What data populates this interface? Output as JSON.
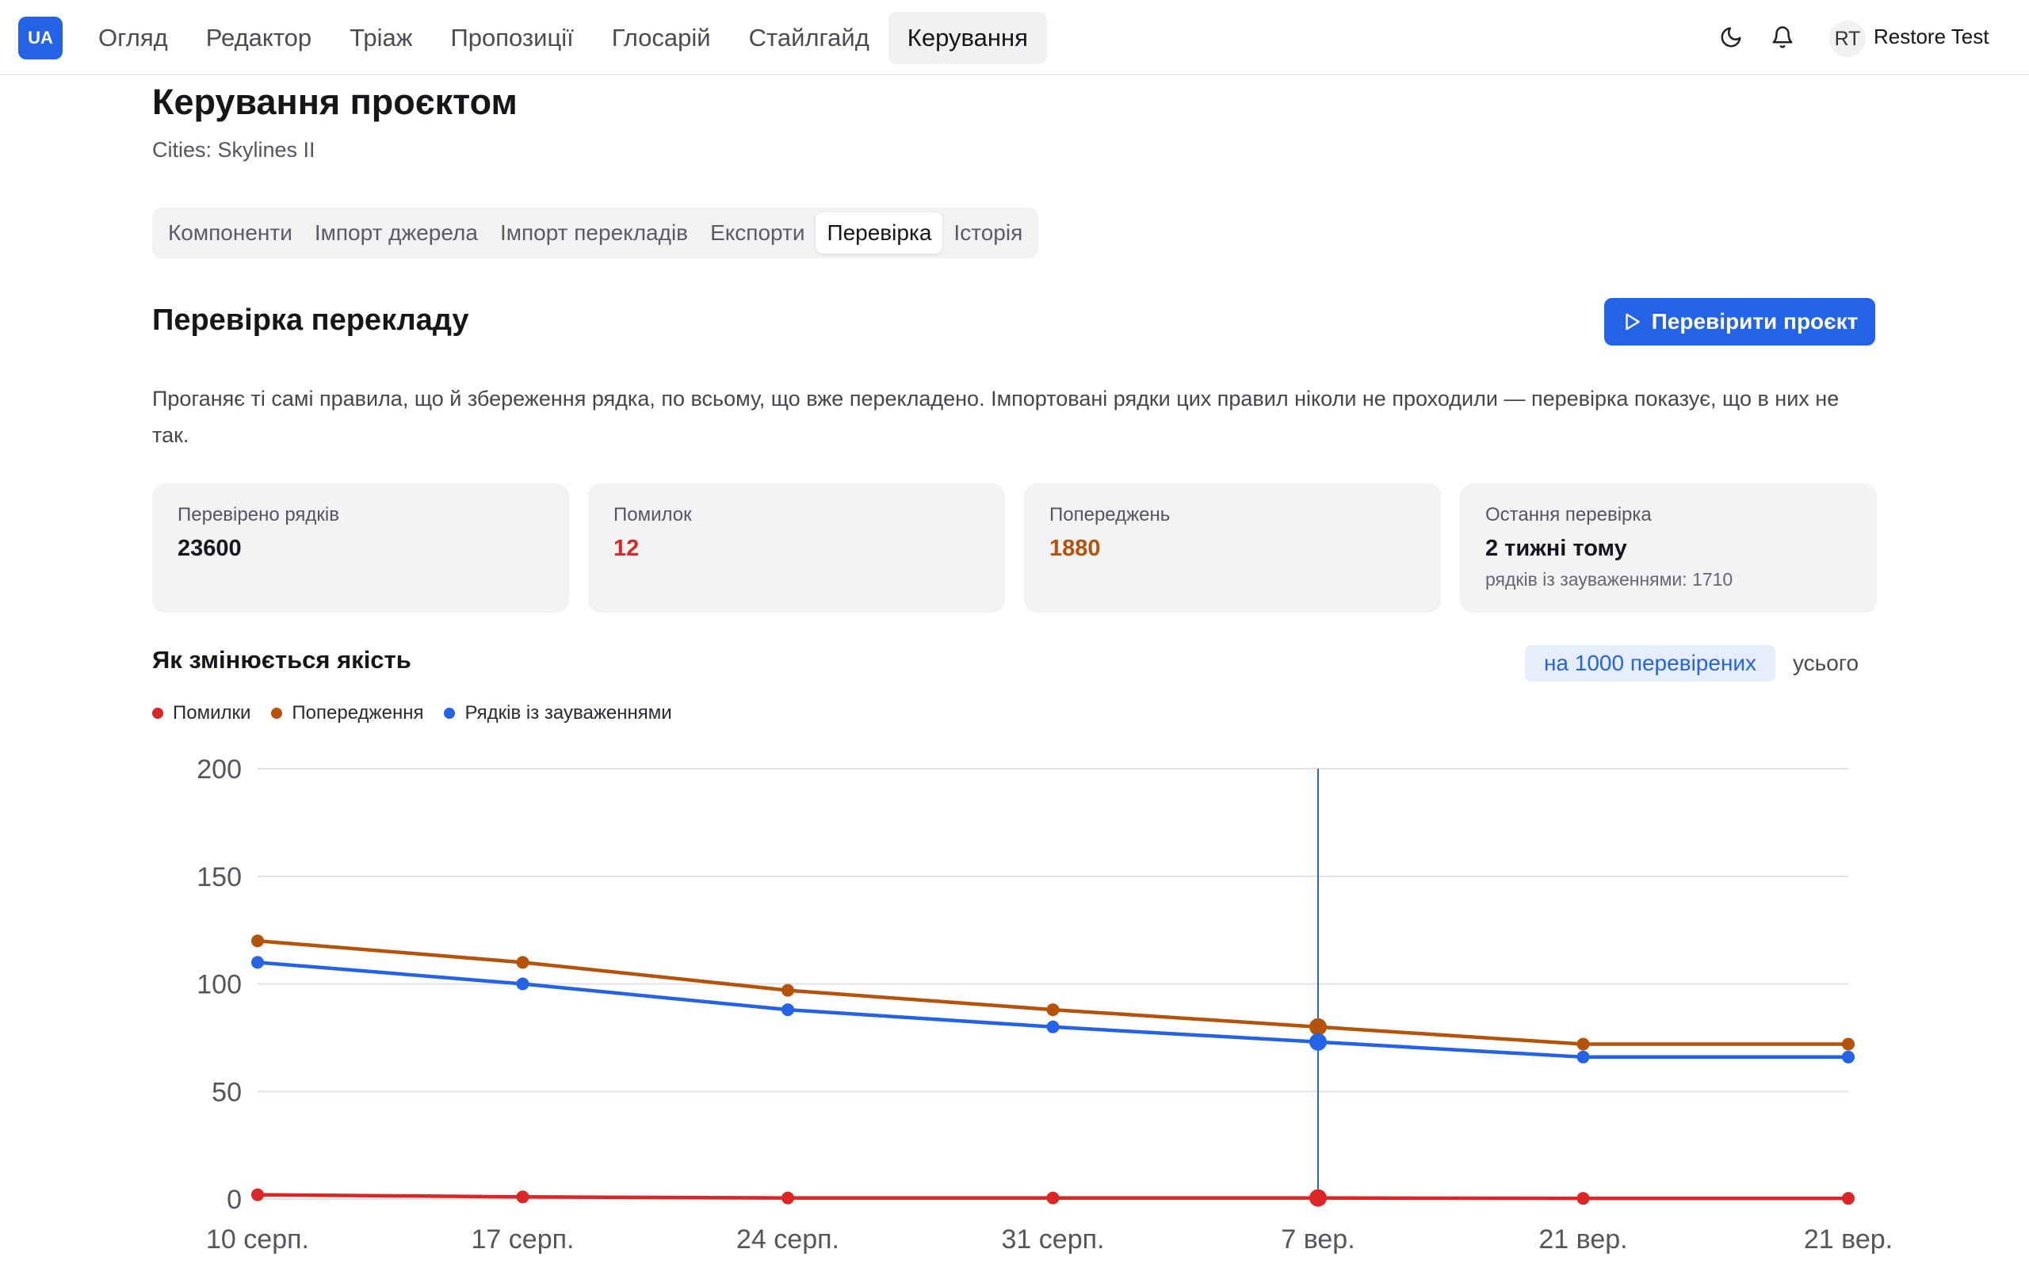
{
  "brand": {
    "logo_text": "UA",
    "color": "#2463e8"
  },
  "nav": {
    "items": [
      {
        "label": "Огляд",
        "active": false
      },
      {
        "label": "Редактор",
        "active": false
      },
      {
        "label": "Тріаж",
        "active": false
      },
      {
        "label": "Пропозиції",
        "active": false
      },
      {
        "label": "Глосарій",
        "active": false
      },
      {
        "label": "Стайлгайд",
        "active": false
      },
      {
        "label": "Керування",
        "active": true
      }
    ]
  },
  "user": {
    "initials": "RT",
    "name": "Restore Test"
  },
  "icons": {
    "theme": "moon-icon",
    "notifications": "bell-icon",
    "run": "play-icon"
  },
  "page": {
    "title": "Керування проєктом",
    "subtitle": "Cities: Skylines II"
  },
  "tabs": [
    {
      "label": "Компоненти",
      "active": false
    },
    {
      "label": "Імпорт джерела",
      "active": false
    },
    {
      "label": "Імпорт перекладів",
      "active": false
    },
    {
      "label": "Експорти",
      "active": false
    },
    {
      "label": "Перевірка",
      "active": true
    },
    {
      "label": "Історія",
      "active": false
    }
  ],
  "section": {
    "title": "Перевірка перекладу",
    "run_button": "Перевірити проєкт",
    "description": "Проганяє ті самі правила, що й збереження рядка, по всьому, що вже перекладено. Імпортовані рядки цих правил ніколи не проходили — перевірка показує, що в них не так."
  },
  "stats": [
    {
      "label": "Перевірено рядків",
      "value": "23600",
      "color": "#16161a"
    },
    {
      "label": "Помилок",
      "value": "12",
      "color": "#dc2626"
    },
    {
      "label": "Попереджень",
      "value": "1880",
      "color": "#b45309"
    },
    {
      "label": "Остання перевірка",
      "value": "2 тижні тому",
      "note": "рядків із зауваженнями: 1710",
      "color": "#16161a"
    }
  ],
  "chart_header": {
    "title": "Як змінюється якість",
    "toggle_active": "на 1000 перевірених",
    "toggle_other": "усього"
  },
  "chart_data": {
    "type": "line",
    "categories": [
      "10 серп.",
      "17 серп.",
      "24 серп.",
      "31 серп.",
      "7 вер.",
      "21 вер.",
      "21 вер."
    ],
    "ylim": [
      0,
      200
    ],
    "yticks": [
      0,
      50,
      100,
      150,
      200
    ],
    "grid": true,
    "legend": "top-left",
    "highlighted_category_index": 4,
    "series": [
      {
        "name": "Помилки",
        "color": "#dc2626",
        "values": [
          2,
          1,
          0.5,
          0.5,
          0.5,
          0.3,
          0.3
        ]
      },
      {
        "name": "Попередження",
        "color": "#b45309",
        "values": [
          120,
          110,
          97,
          88,
          80,
          72,
          72
        ]
      },
      {
        "name": "Рядків із зауваженнями",
        "color": "#2463e8",
        "values": [
          110,
          100,
          88,
          80,
          73,
          66,
          66
        ]
      }
    ]
  }
}
